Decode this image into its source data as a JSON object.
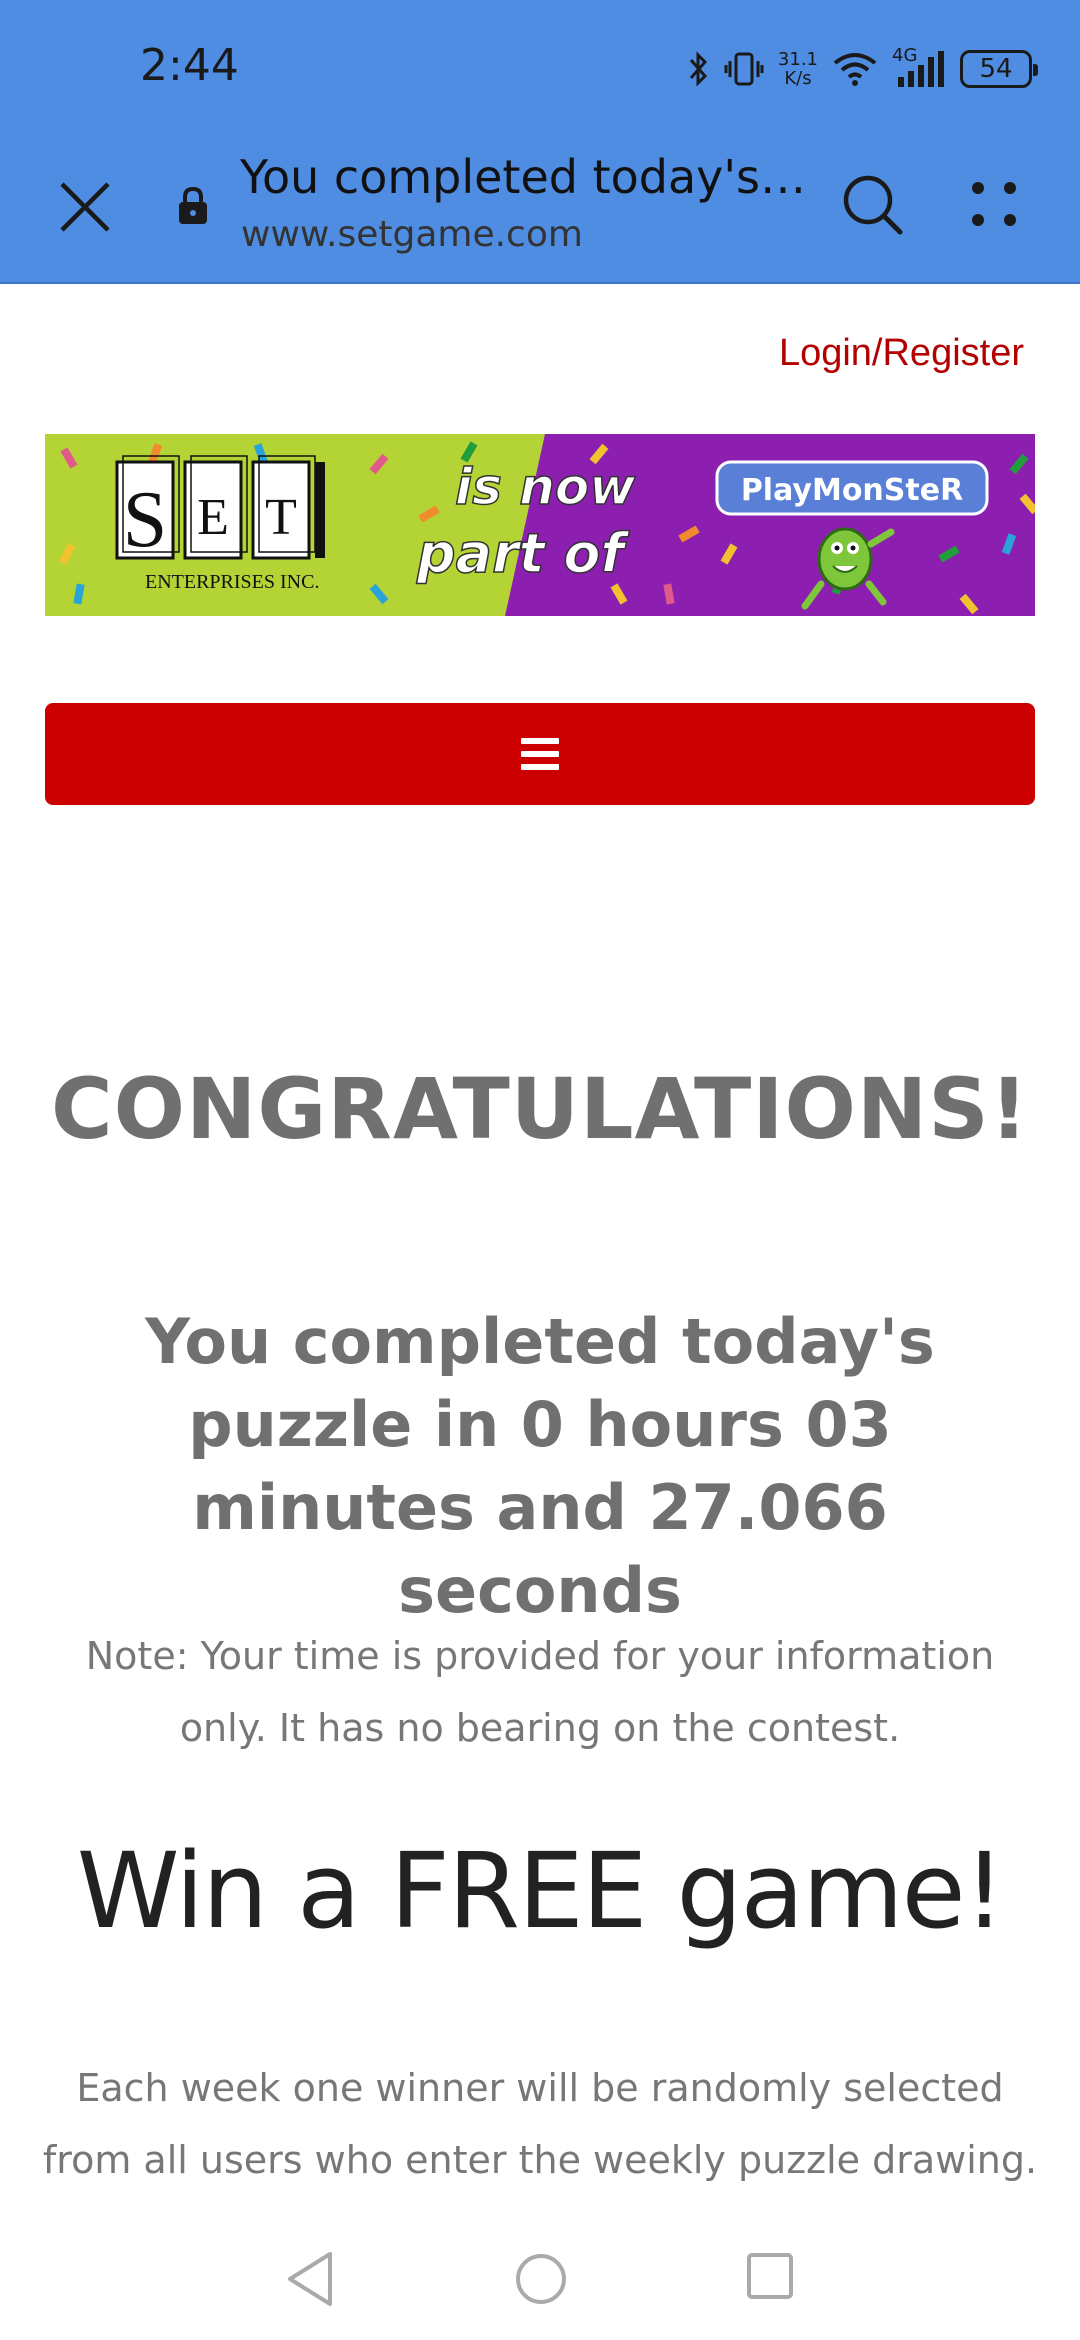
{
  "status_bar": {
    "time": "2:44",
    "net_speed_value": "31.1",
    "net_speed_unit": "K/s",
    "network_type": "4G",
    "battery_level": "54"
  },
  "browser": {
    "page_title": "You completed today's …",
    "url": "www.setgame.com"
  },
  "header": {
    "login_label": "Login/Register"
  },
  "banner": {
    "set_letters": [
      "S",
      "E",
      "T"
    ],
    "enterprises_text": "ENTERPRISES INC.",
    "tagline_line1": "is now",
    "tagline_line2": "part of",
    "playmonster_text": "PlayMonSteR"
  },
  "main": {
    "congrats": "CONGRATULATIONS!",
    "completed_text": "You completed today's puzzle in 0 hours 03 minutes and 27.066 seconds",
    "note_text": "Note: Your time is provided for your information only. It has no bearing on the contest.",
    "win_heading": "Win a FREE game!",
    "win_description": "Each week one winner will be randomly selected from all users who enter the weekly puzzle drawing."
  },
  "colors": {
    "browser_bar": "#4f8de2",
    "menu_bar": "#cc0000",
    "login_link": "#b30000",
    "banner_green": "#b4d334",
    "banner_purple": "#8d1fb0"
  }
}
